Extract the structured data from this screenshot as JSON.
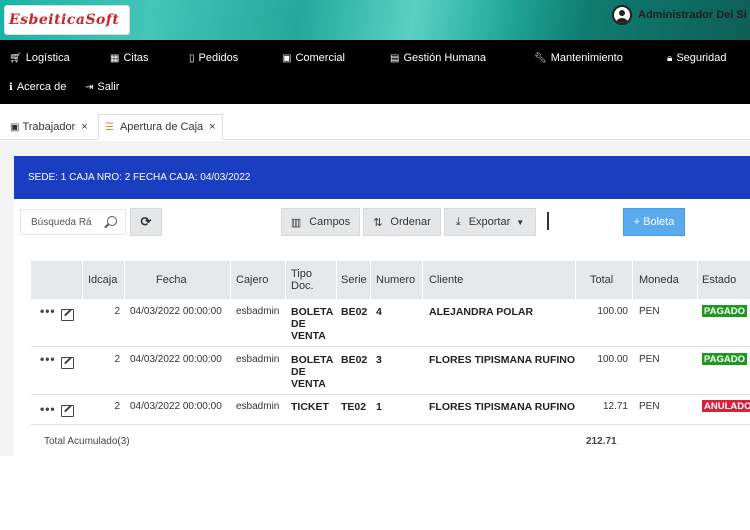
{
  "header": {
    "logo_text": "EsbeiticaSoft",
    "user_name": "Administrador Del Si"
  },
  "nav": {
    "items": [
      {
        "label": "Logística",
        "icon": "cart-icon"
      },
      {
        "label": "Citas",
        "icon": "calendar-icon"
      },
      {
        "label": "Pedidos",
        "icon": "clipboard-icon"
      },
      {
        "label": "Comercial",
        "icon": "video-icon"
      },
      {
        "label": "Gestión Humana",
        "icon": "id-card-icon"
      },
      {
        "label": "Mantenimiento",
        "icon": "wrench-icon"
      },
      {
        "label": "Seguridad",
        "icon": "lock-icon"
      },
      {
        "label": "Acerca de",
        "icon": "info-icon"
      },
      {
        "label": "Salir",
        "icon": "sign-out-icon"
      }
    ]
  },
  "tabs": [
    {
      "label": "Trabajador",
      "close": "×"
    },
    {
      "label": "Apertura de Caja",
      "close": "×"
    }
  ],
  "banner": {
    "text": "SEDE: 1 CAJA NRO: 2 FECHA CAJA: 04/03/2022"
  },
  "toolbar": {
    "search_placeholder": "Búsqueda Rá",
    "campos_label": "Campos",
    "ordenar_label": "Ordenar",
    "exportar_label": "Exportar",
    "new_boleta_label": "+ Boleta"
  },
  "table": {
    "headers": {
      "idcaja": "Idcaja",
      "fecha": "Fecha",
      "cajero": "Cajero",
      "tipo_doc": "Tipo Doc.",
      "serie": "Serie",
      "numero": "Numero",
      "cliente": "Cliente",
      "total": "Total",
      "moneda": "Moneda",
      "estado": "Estado"
    },
    "rows": [
      {
        "idcaja": "2",
        "fecha": "04/03/2022 00:00:00",
        "cajero": "esbadmin",
        "tipo1": "BOLETA",
        "tipo2": "DE",
        "tipo3": "VENTA",
        "serie": "BE02",
        "numero": "4",
        "cliente": "ALEJANDRA POLAR",
        "total": "100.00",
        "moneda": "PEN",
        "estado": "PAGADO"
      },
      {
        "idcaja": "2",
        "fecha": "04/03/2022 00:00:00",
        "cajero": "esbadmin",
        "tipo1": "BOLETA",
        "tipo2": "DE",
        "tipo3": "VENTA",
        "serie": "BE02",
        "numero": "3",
        "cliente": "FLORES TIPISMANA RUFINO",
        "total": "100.00",
        "moneda": "PEN",
        "estado": "PAGADO"
      },
      {
        "idcaja": "2",
        "fecha": "04/03/2022 00:00:00",
        "cajero": "esbadmin",
        "tipo1": "TICKET",
        "tipo2": "",
        "tipo3": "",
        "serie": "TE02",
        "numero": "1",
        "cliente": "FLORES TIPISMANA RUFINO",
        "total": "12.71",
        "moneda": "PEN",
        "estado": "ANULADO"
      }
    ],
    "footer_label": "Total Acumulado(3)",
    "footer_total": "212.71"
  },
  "colors": {
    "paid": "#1e9a1e",
    "void": "#d8203c",
    "banner": "#1a3ec2",
    "primary": "#5aaaf0"
  }
}
